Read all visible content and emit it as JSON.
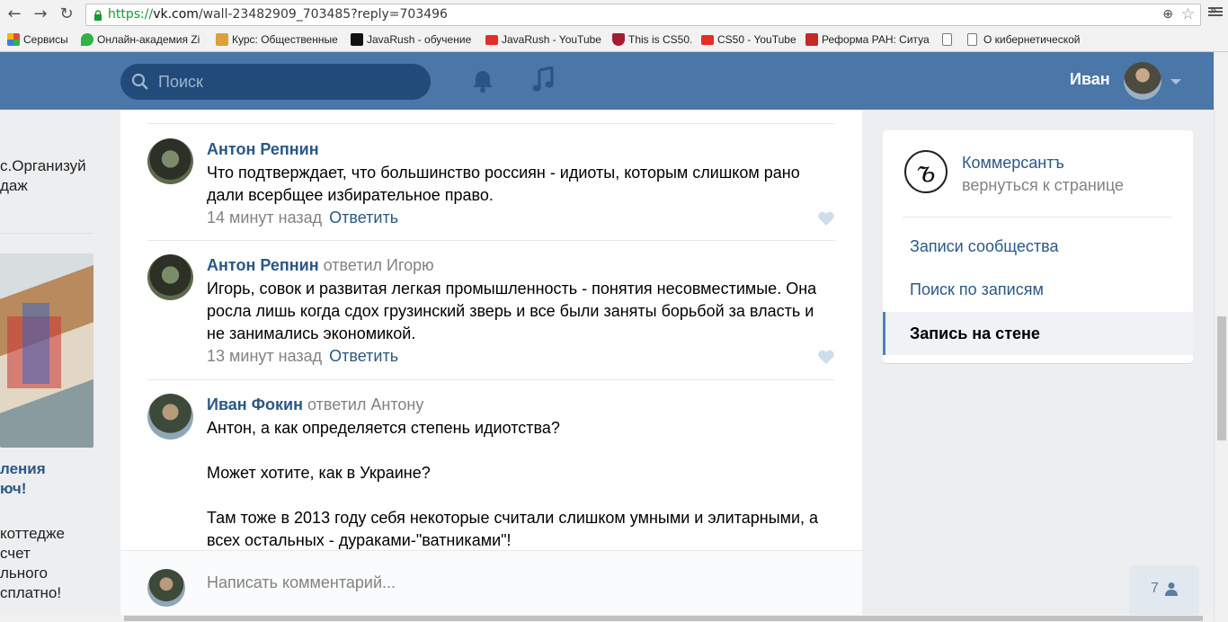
{
  "browser": {
    "url_proto": "https://",
    "url_host": "vk.com",
    "url_path": "/wall-23482909_703485?reply=703496",
    "bookmarks": [
      {
        "label": "Сервисы",
        "icon": "apps-grid-icon",
        "color": "#e04b3a"
      },
      {
        "label": "Онлайн-академия Zi",
        "icon": "map-pin-icon",
        "color": "#2fb344"
      },
      {
        "label": "Курс: Общественные",
        "icon": "course-icon",
        "color": "#d9a23a"
      },
      {
        "label": "JavaRush - обучение",
        "icon": "javarush-icon",
        "color": "#111111"
      },
      {
        "label": "JavaRush - YouTube",
        "icon": "youtube-icon",
        "color": "#e52d27"
      },
      {
        "label": "This is CS50.",
        "icon": "harvard-shield-icon",
        "color": "#a51c30"
      },
      {
        "label": "CS50 - YouTube",
        "icon": "youtube-icon",
        "color": "#e52d27"
      },
      {
        "label": "Реформа РАН: Ситуа",
        "icon": "e-logo-icon",
        "color": "#c62828"
      },
      {
        "label": "",
        "icon": "page-icon",
        "color": "#ffffff"
      },
      {
        "label": "О кибернетической",
        "icon": "page-icon",
        "color": "#ffffff"
      }
    ]
  },
  "header": {
    "search_placeholder": "Поиск",
    "user_name": "Иван"
  },
  "left_column": {
    "line1": "с.Организуй",
    "line2": "даж",
    "ad_title_1": "ления",
    "ad_title_2": "юч!",
    "ad_text_1": "коттедже",
    "ad_text_2": "счет",
    "ad_text_3": "льного",
    "ad_text_4": "сплатно!"
  },
  "comments": [
    {
      "author": "Антон Репнин",
      "replied_to": "",
      "text": "Что подтверждает, что большинство россиян - идиоты, которым слишком рано дали всербщее избирательное право.",
      "time": "14 минут назад",
      "reply_label": "Ответить"
    },
    {
      "author": "Антон Репнин",
      "replied_to": "ответил Игорю",
      "text": "Игорь, совок и развитая легкая промышленность - понятия несовместимые. Она росла лишь когда сдох грузинский зверь и все были заняты борьбой за власть и не занимались экономикой.",
      "time": "13 минут назад",
      "reply_label": "Ответить"
    },
    {
      "author": "Иван Фокин",
      "replied_to": "ответил Антону",
      "text_p1": "Антон, а как определяется степень идиотства?",
      "text_p2": "Может хотите, как в Украине?",
      "text_p3": "Там тоже в 2013 году себя некоторые считали слишком умными и элитарными, а всех остальных - дураками-\"ватниками\"!"
    }
  ],
  "composer": {
    "placeholder": "Написать комментарий..."
  },
  "sidebar": {
    "group_name": "Коммерсантъ",
    "back_label": "вернуться к странице",
    "menu": [
      {
        "label": "Записи сообщества",
        "active": false
      },
      {
        "label": "Поиск по записям",
        "active": false
      },
      {
        "label": "Запись на стене",
        "active": true
      }
    ]
  },
  "online_friends": {
    "count": "7"
  },
  "colors": {
    "vk_blue": "#4a76a8",
    "link": "#2a5885",
    "muted": "#828282"
  }
}
